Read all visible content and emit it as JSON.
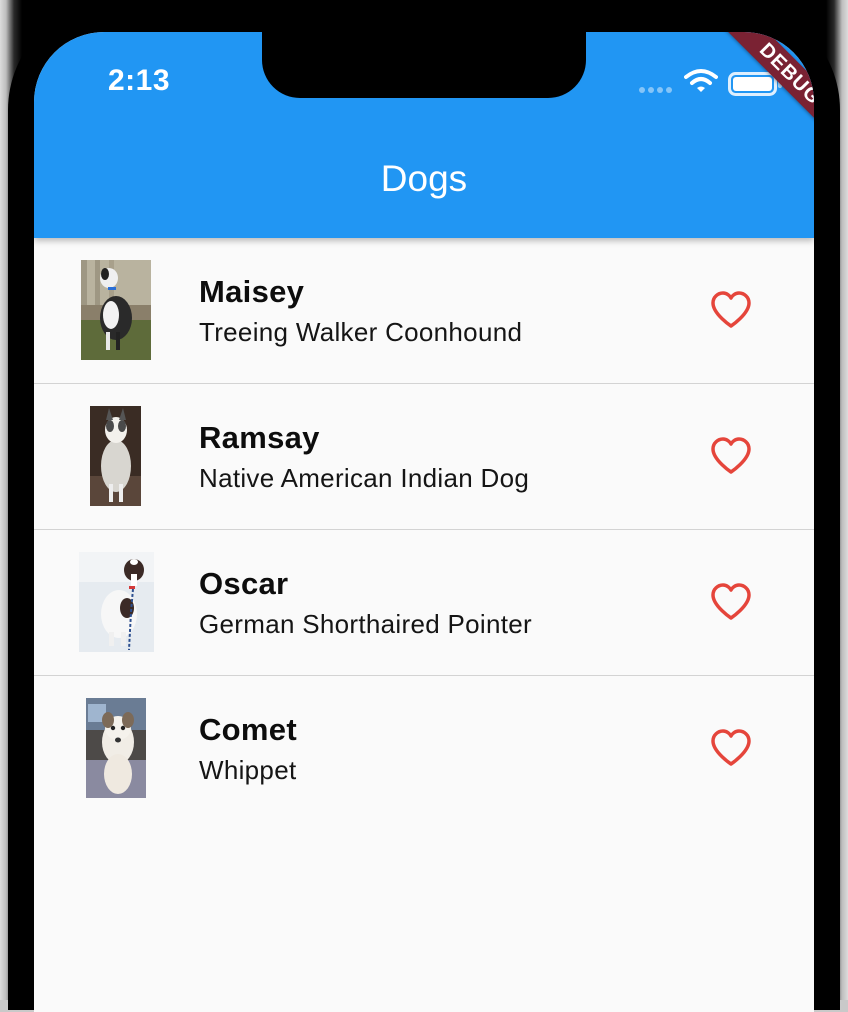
{
  "status_bar": {
    "time": "2:13",
    "icons": [
      "cellular-icon",
      "wifi-icon",
      "battery-icon"
    ]
  },
  "debug_banner": "DEBUG",
  "app_bar": {
    "title": "Dogs"
  },
  "colors": {
    "app_bar": "#2196f3",
    "heart": "#e5453b",
    "debug_banner": "#7a2233",
    "background": "#fafafa"
  },
  "dogs": [
    {
      "name": "Maisey",
      "breed": "Treeing Walker Coonhound",
      "photo": "dog-photo",
      "favorite_icon": "heart-outline-icon"
    },
    {
      "name": "Ramsay",
      "breed": "Native American Indian Dog",
      "photo": "dog-photo",
      "favorite_icon": "heart-outline-icon"
    },
    {
      "name": "Oscar",
      "breed": "German Shorthaired Pointer",
      "photo": "dog-photo",
      "favorite_icon": "heart-outline-icon"
    },
    {
      "name": "Comet",
      "breed": "Whippet",
      "photo": "dog-photo",
      "favorite_icon": "heart-outline-icon"
    }
  ]
}
